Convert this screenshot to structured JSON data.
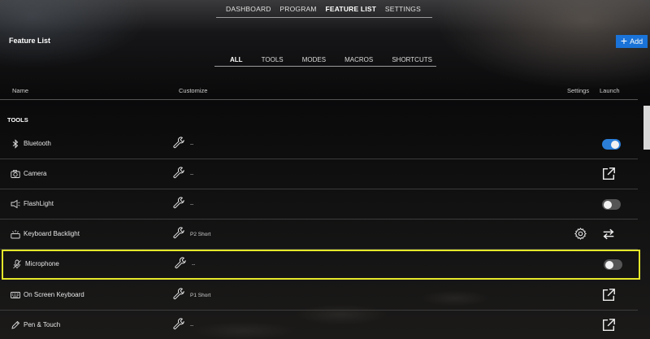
{
  "topnav": {
    "items": [
      {
        "label": "DASHBOARD"
      },
      {
        "label": "PROGRAM"
      },
      {
        "label": "FEATURE LIST",
        "active": true
      },
      {
        "label": "SETTINGS"
      }
    ]
  },
  "page": {
    "title": "Feature List",
    "add_label": "Add"
  },
  "filters": {
    "tabs": [
      {
        "label": "ALL",
        "active": true
      },
      {
        "label": "TOOLS"
      },
      {
        "label": "MODES"
      },
      {
        "label": "MACROS"
      },
      {
        "label": "SHORTCUTS"
      }
    ]
  },
  "columns": {
    "name": "Name",
    "customize": "Customize",
    "settings": "Settings",
    "launch": "Launch"
  },
  "section": {
    "title": "TOOLS"
  },
  "rows": [
    {
      "name": "Bluetooth",
      "icon": "bluetooth-icon",
      "customize": "--",
      "launch": "toggle",
      "toggle_on": true
    },
    {
      "name": "Camera",
      "icon": "camera-icon",
      "customize": "--",
      "launch": "open"
    },
    {
      "name": "FlashLight",
      "icon": "flashlight-icon",
      "customize": "--",
      "launch": "toggle",
      "toggle_on": false
    },
    {
      "name": "Keyboard Backlight",
      "icon": "keyboard-backlight-icon",
      "customize": "P2 Short",
      "launch": "cycle",
      "has_settings": true
    },
    {
      "name": "Microphone",
      "icon": "microphone-icon",
      "customize": "--",
      "launch": "toggle",
      "toggle_on": false,
      "highlighted": true
    },
    {
      "name": "On Screen Keyboard",
      "icon": "keyboard-icon",
      "customize": "P1 Short",
      "launch": "open"
    },
    {
      "name": "Pen & Touch",
      "icon": "pen-touch-icon",
      "customize": "--",
      "launch": "open"
    }
  ],
  "colors": {
    "accent": "#1a73d8",
    "toggle_on": "#2b7fd9",
    "highlight": "#e4e72a"
  }
}
